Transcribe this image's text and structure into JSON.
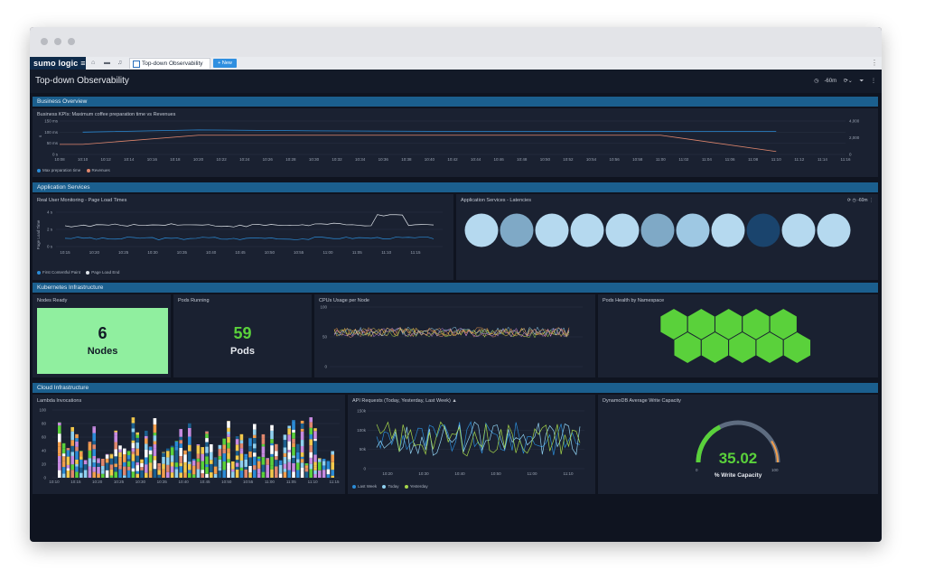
{
  "app": {
    "logo": "sumo logic",
    "menu_icon": "hamburger-icon"
  },
  "tabs": [
    {
      "label": "Top-down Observability",
      "active": true
    }
  ],
  "new_button": "+ New",
  "dashboard": {
    "title": "Top-down Observability",
    "time_range": "-60m"
  },
  "sections": {
    "business": "Business Overview",
    "app": "Application Services",
    "k8s": "Kubernetes Infrastructure",
    "cloud": "Cloud Infrastructure"
  },
  "panels": {
    "kpi": {
      "title": "Business KPIs: Maximum coffee preparation time vs Revenues",
      "y_left": [
        "150 ms",
        "100 ms",
        "50 ms",
        "0 s"
      ],
      "y_right": [
        "4,000",
        "2,000",
        "0"
      ],
      "ylabel": "s",
      "x": [
        "10:08",
        "10:10",
        "10:12",
        "10:14",
        "10:16",
        "10:18",
        "10:20",
        "10:22",
        "10:24",
        "10:26",
        "10:28",
        "10:30",
        "10:32",
        "10:34",
        "10:36",
        "10:38",
        "10:40",
        "10:42",
        "10:44",
        "10:46",
        "10:48",
        "10:50",
        "10:52",
        "10:54",
        "10:56",
        "10:58",
        "11:00",
        "11:02",
        "11:04",
        "11:06",
        "11:08",
        "11:10",
        "11:12",
        "11:14",
        "11:16"
      ],
      "legend": [
        "Max preparation time",
        "Revenues"
      ]
    },
    "rum": {
      "title": "Real User Monitoring - Page Load Times",
      "ylabel": "Page Load Time",
      "y": [
        "4 s",
        "2 s",
        "0 s"
      ],
      "x": [
        "10:15",
        "10:20",
        "10:25",
        "10:30",
        "10:35",
        "10:40",
        "10:45",
        "10:50",
        "10:55",
        "11:00",
        "11:05",
        "11:10",
        "11:15"
      ],
      "legend": [
        "First Contentful Paint",
        "Page Load End"
      ]
    },
    "latency": {
      "title": "Application Services - Latencies",
      "time": "-60m",
      "circles": [
        "#b5d9ef",
        "#7fa9c6",
        "#b5d9ef",
        "#b5d9ef",
        "#b5d9ef",
        "#7fa9c6",
        "#9ec8e3",
        "#b5d9ef",
        "#1a446d",
        "#b5d9ef",
        "#b5d9ef"
      ]
    },
    "nodes": {
      "title": "Nodes Ready",
      "value": "6",
      "unit": "Nodes"
    },
    "pods": {
      "title": "Pods Running",
      "value": "59",
      "unit": "Pods"
    },
    "cpu": {
      "title": "CPUs Usage per Node",
      "y": [
        "100",
        "50",
        "0"
      ]
    },
    "podhealth": {
      "title": "Pods Health by Namespace"
    },
    "lambda": {
      "title": "Lambda Invocations",
      "y": [
        "100",
        "80",
        "60",
        "40",
        "20",
        "0"
      ],
      "x": [
        "10:10",
        "10:15",
        "10:20",
        "10:25",
        "10:30",
        "10:35",
        "10:40",
        "10:45",
        "10:50",
        "10:55",
        "11:00",
        "11:05",
        "11:10",
        "11:15"
      ]
    },
    "api": {
      "title": "API Requests (Today, Yesterday, Last Week)",
      "y": [
        "150k",
        "100k",
        "50k",
        "0"
      ],
      "x": [
        "10:20",
        "10:30",
        "10:40",
        "10:50",
        "11:00",
        "11:10"
      ],
      "legend": [
        "Last Week",
        "Today",
        "Yesterday"
      ]
    },
    "dynamo": {
      "title": "DynamoDB Average Write Capacity",
      "value": "35.02",
      "label": "% Write Capacity",
      "min": "0",
      "max": "100"
    }
  },
  "chart_data": [
    {
      "type": "line",
      "title": "Business KPIs: Maximum coffee preparation time vs Revenues",
      "x": [
        "10:08",
        "10:10",
        "10:20",
        "10:30",
        "10:40",
        "10:50",
        "11:00",
        "11:10"
      ],
      "series": [
        {
          "name": "Max preparation time",
          "values": [
            100,
            100,
            110,
            106,
            104,
            104,
            104,
            104
          ]
        },
        {
          "name": "Revenues",
          "values": [
            1200,
            1200,
            2300,
            2300,
            2300,
            2300,
            2300,
            350
          ]
        }
      ]
    },
    {
      "type": "line",
      "title": "Real User Monitoring - Page Load Times",
      "series": [
        {
          "name": "First Contentful Paint",
          "values": [
            1.0,
            0.9,
            1.0,
            0.9,
            1.0,
            0.9,
            1.0,
            0.9,
            1.0,
            1.0,
            1.0,
            1.0,
            1.0
          ]
        },
        {
          "name": "Page Load End",
          "values": [
            2.4,
            2.5,
            2.5,
            2.6,
            2.5,
            2.4,
            2.5,
            2.5,
            2.6,
            2.5,
            3.6,
            2.5,
            2.5
          ]
        }
      ]
    },
    {
      "type": "gauge",
      "title": "DynamoDB Average Write Capacity",
      "value": 35.02,
      "min": 0,
      "max": 100
    }
  ],
  "colors": {
    "accent": "#1b5f8e",
    "good": "#5ad13b",
    "tile": "#90ef9f"
  }
}
